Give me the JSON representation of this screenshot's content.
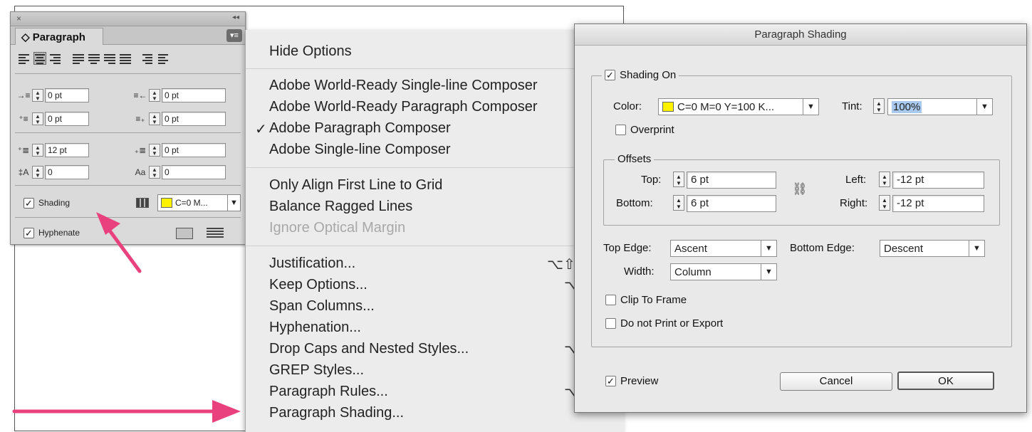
{
  "panel": {
    "close_glyph": "×",
    "collapse_glyph": "◂◂",
    "tab_label": "◇ Paragraph",
    "menu_glyph": "▾≡",
    "fields": {
      "left_indent": "0 pt",
      "right_indent": "0 pt",
      "first_line_indent": "0 pt",
      "last_line_indent": "0 pt",
      "space_before": "12 pt",
      "space_after": "0 pt",
      "drop_cap_lines": "0",
      "drop_cap_chars": "0"
    },
    "shading_label": "Shading",
    "shading_checked": "✓",
    "shading_color": "C=0 M...",
    "hyphenate_label": "Hyphenate",
    "hyphenate_checked": "✓"
  },
  "menu": {
    "items": [
      "Hide Options",
      "Adobe World-Ready Single-line Composer",
      "Adobe World-Ready Paragraph Composer",
      "Adobe Paragraph Composer",
      "Adobe Single-line Composer",
      "Only Align First Line to Grid",
      "Balance Ragged Lines",
      "Ignore Optical Margin",
      "Justification...",
      "Keep Options...",
      "Span Columns...",
      "Hyphenation...",
      "Drop Caps and Nested Styles...",
      "GREP Styles...",
      "Paragraph Rules...",
      "Paragraph Shading..."
    ],
    "checked_glyph": "✓",
    "shortcuts": {
      "justification": "⌥⇧",
      "keep": "⌥",
      "drop_caps": "⌥",
      "rules": "⌥"
    }
  },
  "dialog": {
    "title": "Paragraph Shading",
    "shading_on_label": "Shading On",
    "shading_on_checked": "✓",
    "color_label": "Color:",
    "color_value": "C=0 M=0 Y=100 K...",
    "tint_label": "Tint:",
    "tint_value": "100%",
    "overprint_label": "Overprint",
    "offsets_title": "Offsets",
    "top_label": "Top:",
    "top_value": "6 pt",
    "bottom_label": "Bottom:",
    "bottom_value": "6 pt",
    "left_label": "Left:",
    "left_value": "-12 pt",
    "right_label": "Right:",
    "right_value": "-12 pt",
    "top_edge_label": "Top Edge:",
    "top_edge_value": "Ascent",
    "bottom_edge_label": "Bottom Edge:",
    "bottom_edge_value": "Descent",
    "width_label": "Width:",
    "width_value": "Column",
    "clip_label": "Clip To Frame",
    "noprint_label": "Do not Print or Export",
    "preview_label": "Preview",
    "preview_checked": "✓",
    "cancel_label": "Cancel",
    "ok_label": "OK"
  },
  "colors": {
    "arrow": "#e8417e",
    "swatch_yellow": "#fff200",
    "tint_highlight": "#a9c9ef"
  }
}
